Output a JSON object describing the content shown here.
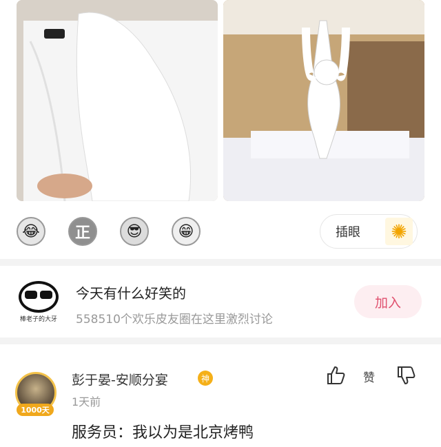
{
  "photos": [
    {
      "name": "bed-photo"
    },
    {
      "name": "towel-monkey-photo"
    }
  ],
  "reactions": {
    "emojis": [
      {
        "icon": "laughing-face-icon",
        "glyph": "😂"
      },
      {
        "icon": "zheng-badge-icon",
        "glyph": "正"
      },
      {
        "icon": "sunglasses-face-icon",
        "glyph": "😎"
      },
      {
        "icon": "grinning-face-icon",
        "glyph": "😁"
      }
    ],
    "insert_label": "插眼",
    "insert_icon": "sunflower-icon"
  },
  "group": {
    "title": "今天有什么好笑的",
    "subtitle": "558510个欢乐皮友圈在这里激烈讨论",
    "avatar_caption": "棒老子的大牙",
    "join_label": "加入"
  },
  "comment": {
    "author": "彭于晏-安顺分宴",
    "god_badge": "神",
    "avatar_badge": "1000天",
    "time": "1天前",
    "text": "服务员：我以为是北京烤鸭",
    "like_label": "赞"
  },
  "colors": {
    "accent": "#e0506e",
    "join_bg": "#fdeef1",
    "badge": "#f5b019",
    "divider": "#f3f3f3"
  }
}
